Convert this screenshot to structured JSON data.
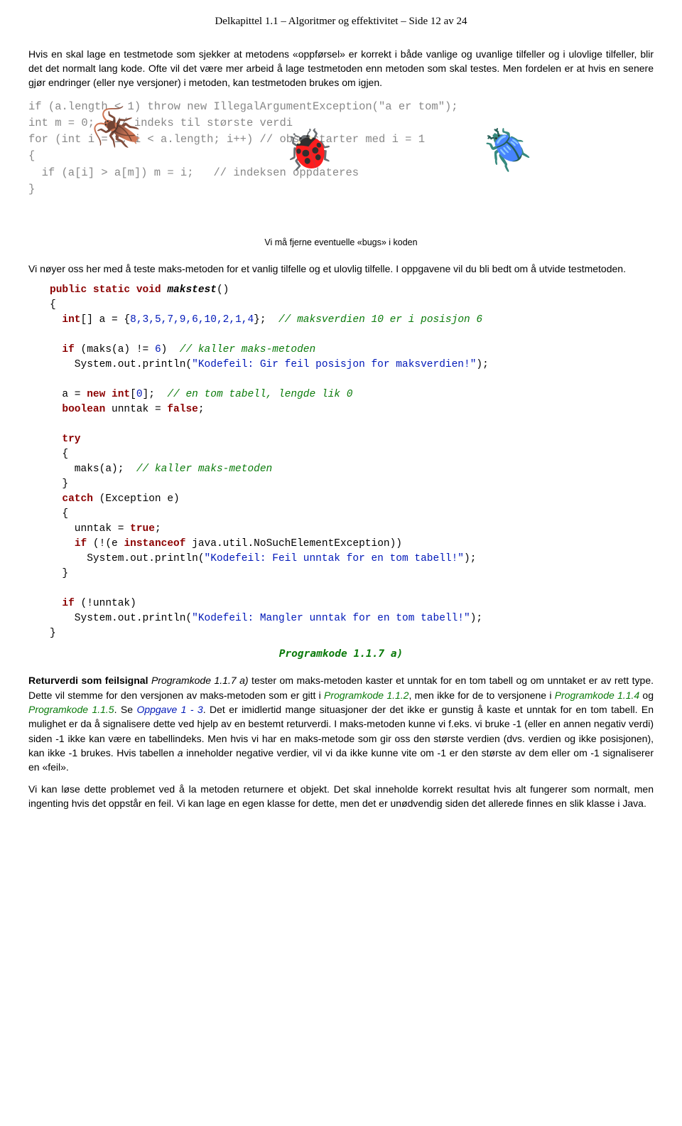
{
  "header": "Delkapittel 1.1 – Algoritmer og effektivitet – Side 12 av 24",
  "para1": "Hvis en skal lage en testmetode som sjekker at metodens «oppførsel» er korrekt i både vanlige og uvanlige tilfeller og i ulovlige tilfeller, blir det det normalt lang kode. Ofte vil det være mer arbeid å lage testmetoden enn metoden som skal testes. Men fordelen er at hvis en senere gjør endringer (eller nye versjoner) i metoden, kan testmetoden brukes om igjen.",
  "bug_code_bg": "if (a.length < 1) throw new IllegalArgumentException(\"a er tom\");\nint m = 0;   // indeks til største verdi\nfor (int i = 1; i < a.length; i++) // obs: starter med i = 1\n{\n  if (a[i] > a[m]) m = i;   // indeksen oppdateres\n}",
  "caption": "Vi må fjerne eventuelle «bugs» i koden",
  "para2": "Vi nøyer oss her med å teste maks-metoden for et vanlig tilfelle og et ulovlig tilfelle. I oppgavene vil du bli bedt om å utvide testmetoden.",
  "code": {
    "l1a": "public static void",
    "l1b": " makstest",
    "l1c": "()",
    "l2": "{",
    "l3a": "int",
    "l3b": "[] a = {",
    "l3nums": "8,3,5,7,9,6,10,2,1,4",
    "l3c": "};  ",
    "l3cm": "// maksverdien 10 er i posisjon 6",
    "l4a": "if",
    "l4b": " (maks(a) != ",
    "l4n": "6",
    "l4c": ")  ",
    "l4cm": "// kaller maks-metoden",
    "l5a": "  System.out.println(",
    "l5s": "\"Kodefeil: Gir feil posisjon for maksverdien!\"",
    "l5b": ");",
    "l6a": "a = ",
    "l6kw": "new int",
    "l6b": "[",
    "l6n": "0",
    "l6c": "];  ",
    "l6cm": "// en tom tabell, lengde lik 0",
    "l7a": "boolean",
    "l7b": " unntak = ",
    "l7kw": "false",
    "l7c": ";",
    "l8": "try",
    "l9": "{",
    "l10a": "  maks(a);  ",
    "l10cm": "// kaller maks-metoden",
    "l11": "}",
    "l12a": "catch",
    "l12b": " (Exception e)",
    "l13": "{",
    "l14a": "  unntak = ",
    "l14kw": "true",
    "l14b": ";",
    "l15a": "if",
    "l15b": " (!(e ",
    "l15kw": "instanceof",
    "l15c": " java.util.NoSuchElementException))",
    "l16a": "    System.out.println(",
    "l16s": "\"Kodefeil: Feil unntak for en tom tabell!\"",
    "l16b": ");",
    "l17": "}",
    "l18a": "if",
    "l18b": " (!unntak)",
    "l19a": "  System.out.println(",
    "l19s": "\"Kodefeil: Mangler unntak for en tom tabell!\"",
    "l19b": ");",
    "l20": "}"
  },
  "prog_label": "Programkode 1.1.7 a)",
  "section": {
    "title": "Returverdi som feilsignal ",
    "p1a": "Programkode 1.1.7 a)",
    "p1b": " tester om maks-metoden kaster et unntak for en tom tabell og om unntaket er av rett type. Dette vil stemme for den versjonen av maks-metoden som er gitt i ",
    "p1c": "Programkode 1.1.2",
    "p1d": ", men ikke for de to versjonene i ",
    "p1e": "Programkode 1.1.4",
    "p1f": " og ",
    "p1g": "Programkode 1.1.5",
    "p1h": ". Se ",
    "p1i": "Oppgave 1 - 3",
    "p1j": ". Det er imidlertid mange situasjoner der det ikke er gunstig å kaste et unntak for en tom tabell. En mulighet er da å signalisere dette ved hjelp av en bestemt returverdi. I maks-metoden kunne vi f.eks. vi bruke -1 (eller en annen negativ verdi) siden -1 ikke kan være en tabellindeks. Men hvis vi har en maks-metode som gir oss den største verdien (dvs. verdien og ikke posisjonen), kan ikke -1 brukes. Hvis tabellen ",
    "p1k": "a",
    "p1l": " inneholder negative verdier, vil vi da ikke kunne vite om -1 er den største av dem eller om -1 signaliserer en «feil»."
  },
  "para3": "Vi kan løse dette problemet ved å la metoden returnere et objekt. Det skal inneholde korrekt resultat hvis alt fungerer som normalt, men ingenting hvis det oppstår en feil. Vi kan lage en egen klasse for dette, men det er unødvendig siden det allerede finnes en slik klasse i Java."
}
